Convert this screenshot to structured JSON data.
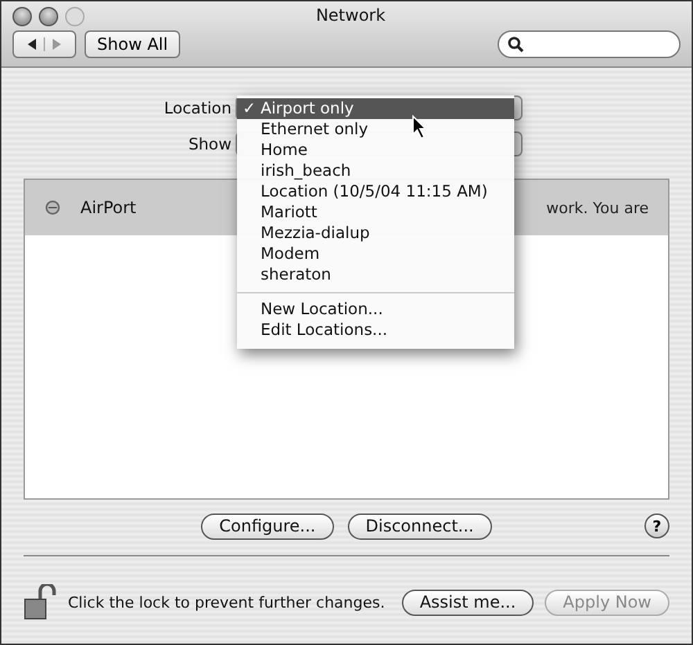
{
  "window": {
    "title": "Network"
  },
  "toolbar": {
    "show_all": "Show All"
  },
  "location": {
    "label": "Location",
    "menu": {
      "items": [
        {
          "label": "Airport only",
          "selected": true
        },
        {
          "label": "Ethernet only",
          "selected": false
        },
        {
          "label": "Home",
          "selected": false
        },
        {
          "label": "irish_beach",
          "selected": false
        },
        {
          "label": "Location (10/5/04 11:15 AM)",
          "selected": false
        },
        {
          "label": "Mariott",
          "selected": false
        },
        {
          "label": "Mezzia-dialup",
          "selected": false
        },
        {
          "label": "Modem",
          "selected": false
        },
        {
          "label": "sheraton",
          "selected": false
        }
      ],
      "check": "✓",
      "actions": [
        "New Location...",
        "Edit Locations..."
      ]
    }
  },
  "show": {
    "label": "Show"
  },
  "services": [
    {
      "name": "AirPort",
      "selected": true,
      "status": "work. You are"
    }
  ],
  "buttons": [
    "Configure...",
    "Disconnect..."
  ],
  "help": "?",
  "lock": {
    "text": "Click the lock to prevent further changes."
  },
  "footer_buttons": [
    {
      "label": "Assist me...",
      "disabled": false
    },
    {
      "label": "Apply Now",
      "disabled": true
    }
  ]
}
